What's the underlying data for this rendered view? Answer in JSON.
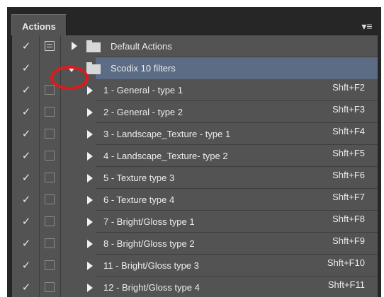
{
  "panel": {
    "tab_label": "Actions",
    "menu_icon": "panel-menu-icon"
  },
  "rows": [
    {
      "check": "✓",
      "label": "Default Actions",
      "shortcut": "",
      "type": "set",
      "expanded": false,
      "dialog": true
    },
    {
      "check": "✓",
      "label": "Scodix 10 filters",
      "shortcut": "",
      "type": "set",
      "expanded": true,
      "selected": true
    },
    {
      "check": "✓",
      "label": "1 - General  - type 1",
      "shortcut": "Shft+F2",
      "type": "action"
    },
    {
      "check": "✓",
      "label": "2 - General - type 2",
      "shortcut": "Shft+F3",
      "type": "action"
    },
    {
      "check": "✓",
      "label": "3 - Landscape_Texture - type 1",
      "shortcut": "Shft+F4",
      "type": "action"
    },
    {
      "check": "✓",
      "label": "4 - Landscape_Texture- type 2",
      "shortcut": "Shft+F5",
      "type": "action"
    },
    {
      "check": "✓",
      "label": "5 - Texture type 3",
      "shortcut": "Shft+F6",
      "type": "action"
    },
    {
      "check": "✓",
      "label": "6 - Texture type 4",
      "shortcut": "Shft+F7",
      "type": "action"
    },
    {
      "check": "✓",
      "label": "7 - Bright/Gloss type 1",
      "shortcut": "Shft+F8",
      "type": "action"
    },
    {
      "check": "✓",
      "label": "8 - Bright/Gloss type 2",
      "shortcut": "Shft+F9",
      "type": "action"
    },
    {
      "check": "✓",
      "label": "11 - Bright/Gloss type 3",
      "shortcut": "Shft+F10",
      "type": "action"
    },
    {
      "check": "✓",
      "label": "12 - Bright/Gloss type 4",
      "shortcut": "Shft+F11",
      "type": "action"
    }
  ],
  "colors": {
    "panel_bg": "#535353",
    "selected_row": "#5b6c84",
    "annotation_circle": "#e0191d"
  }
}
